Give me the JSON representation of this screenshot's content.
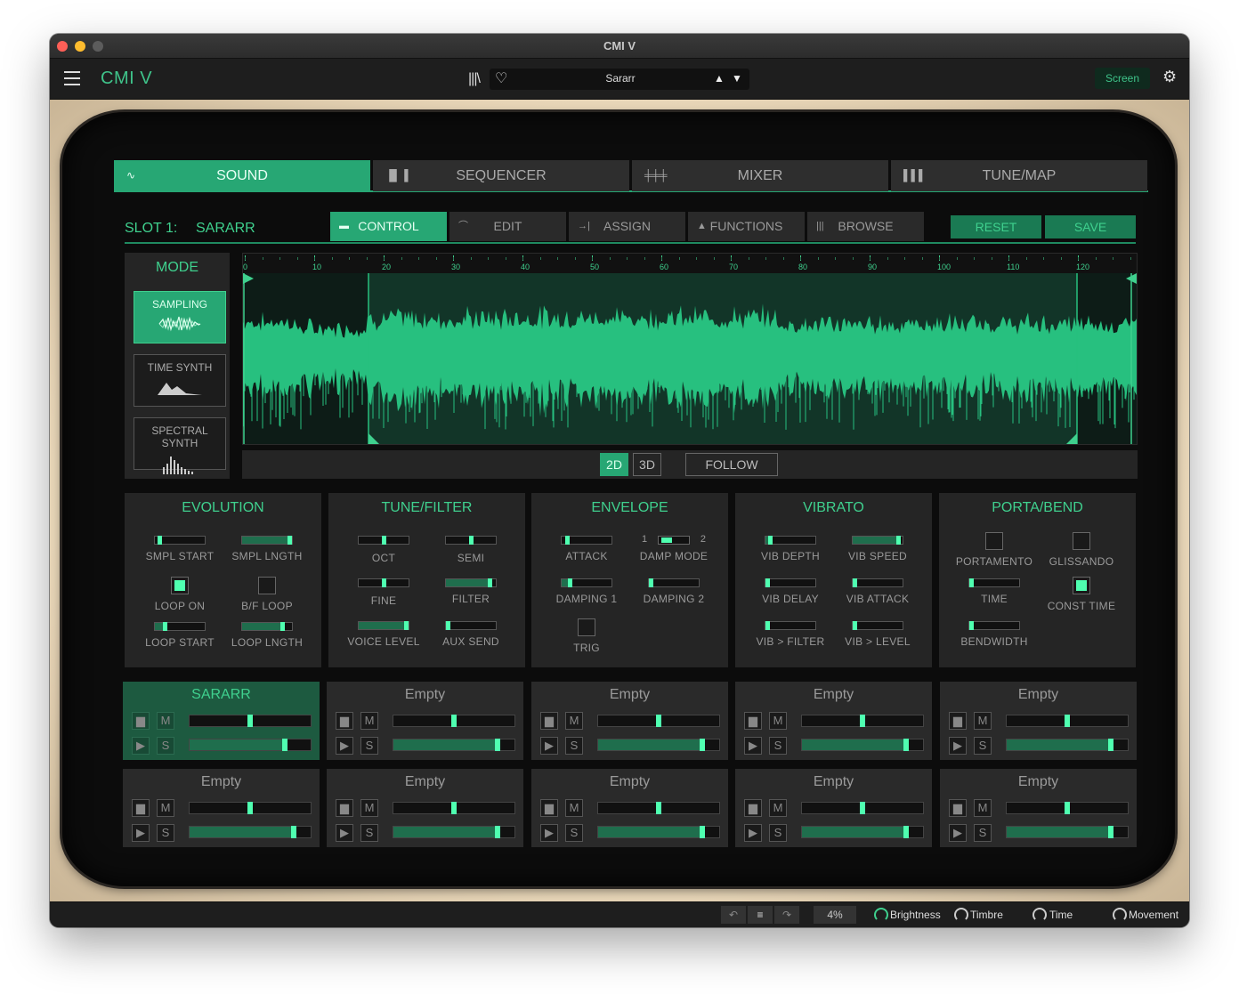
{
  "window": {
    "title": "CMI V"
  },
  "appbar": {
    "app_name": "CMI V",
    "preset_name": "Sararr",
    "screen_label": "Screen"
  },
  "main_tabs": [
    "SOUND",
    "SEQUENCER",
    "MIXER",
    "TUNE/MAP"
  ],
  "slot": {
    "label": "SLOT 1:",
    "name": "SARARR"
  },
  "sub_tabs": [
    "CONTROL",
    "EDIT",
    "ASSIGN",
    "FUNCTIONS",
    "BROWSE"
  ],
  "actions": {
    "reset": "RESET",
    "save": "SAVE"
  },
  "mode": {
    "title": "MODE",
    "options": [
      "SAMPLING",
      "TIME SYNTH",
      "SPECTRAL SYNTH"
    ],
    "selected": "SAMPLING"
  },
  "waveform": {
    "ruler": [
      "0",
      "10",
      "20",
      "30",
      "40",
      "50",
      "60",
      "70",
      "80",
      "90",
      "100",
      "110",
      "120"
    ],
    "view_2d": "2D",
    "view_3d": "3D",
    "follow": "FOLLOW",
    "selected_view": "2D",
    "color": "#27c07f"
  },
  "panels": {
    "evolution": {
      "title": "EVOLUTION",
      "smpl_start": "SMPL START",
      "smpl_lngth": "SMPL LNGTH",
      "loop_on": "LOOP ON",
      "bf_loop": "B/F LOOP",
      "loop_start": "LOOP START",
      "loop_lngth": "LOOP LNGTH"
    },
    "tune_filter": {
      "title": "TUNE/FILTER",
      "oct": "OCT",
      "semi": "SEMI",
      "fine": "FINE",
      "filter": "FILTER",
      "voice_level": "VOICE LEVEL",
      "aux_send": "AUX SEND"
    },
    "envelope": {
      "title": "ENVELOPE",
      "attack": "ATTACK",
      "damp_mode": "DAMP MODE",
      "damp_1": "1",
      "damp_2": "2",
      "damping_1": "DAMPING 1",
      "damping_2": "DAMPING 2",
      "trig": "TRIG"
    },
    "vibrato": {
      "title": "VIBRATO",
      "vib_depth": "VIB DEPTH",
      "vib_speed": "VIB SPEED",
      "vib_delay": "VIB DELAY",
      "vib_attack": "VIB ATTACK",
      "vib_filter": "VIB > FILTER",
      "vib_level": "VIB > LEVEL"
    },
    "porta_bend": {
      "title": "PORTA/BEND",
      "portamento": "PORTAMENTO",
      "glissando": "GLISSANDO",
      "time": "TIME",
      "const_time": "CONST TIME",
      "bendwidth": "BENDWIDTH"
    }
  },
  "channels": {
    "c1": {
      "name": "SARARR",
      "m": "M",
      "s": "S"
    },
    "c2": {
      "name": "Empty",
      "m": "M",
      "s": "S"
    },
    "c3": {
      "name": "Empty",
      "m": "M",
      "s": "S"
    },
    "c4": {
      "name": "Empty",
      "m": "M",
      "s": "S"
    },
    "c5": {
      "name": "Empty",
      "m": "M",
      "s": "S"
    },
    "c6": {
      "name": "Empty",
      "m": "M",
      "s": "S"
    },
    "c7": {
      "name": "Empty",
      "m": "M",
      "s": "S"
    },
    "c8": {
      "name": "Empty",
      "m": "M",
      "s": "S"
    },
    "c9": {
      "name": "Empty",
      "m": "M",
      "s": "S"
    },
    "c10": {
      "name": "Empty",
      "m": "M",
      "s": "S"
    }
  },
  "statusbar": {
    "cpu": "4%",
    "brightness": "Brightness",
    "timbre": "Timbre",
    "time": "Time",
    "movement": "Movement"
  },
  "accent_color": "#3fd08e"
}
